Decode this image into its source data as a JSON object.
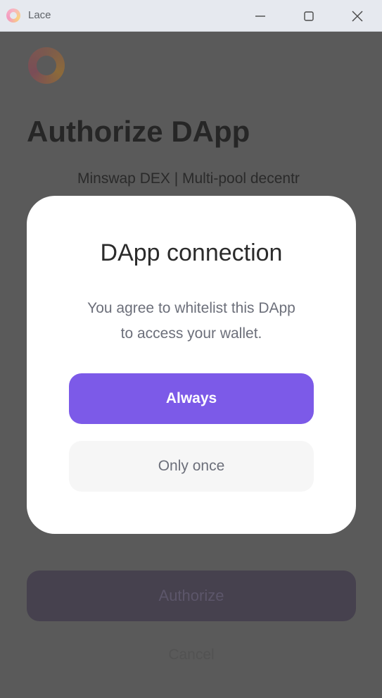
{
  "window": {
    "title": "Lace",
    "controls": {
      "minimize": "minimize-icon",
      "maximize": "maximize-icon",
      "close": "close-icon"
    }
  },
  "background": {
    "heading": "Authorize DApp",
    "dapp_name": "Minswap DEX | Multi-pool decentr",
    "authorize_label": "Authorize",
    "cancel_label": "Cancel"
  },
  "modal": {
    "title": "DApp connection",
    "description_line1": "You agree to whitelist this DApp",
    "description_line2": "to access your wallet.",
    "always_label": "Always",
    "once_label": "Only once"
  },
  "colors": {
    "accent": "#7c5ae8",
    "overlay": "#5a5a5a",
    "secondary_button": "#f6f6f6"
  }
}
